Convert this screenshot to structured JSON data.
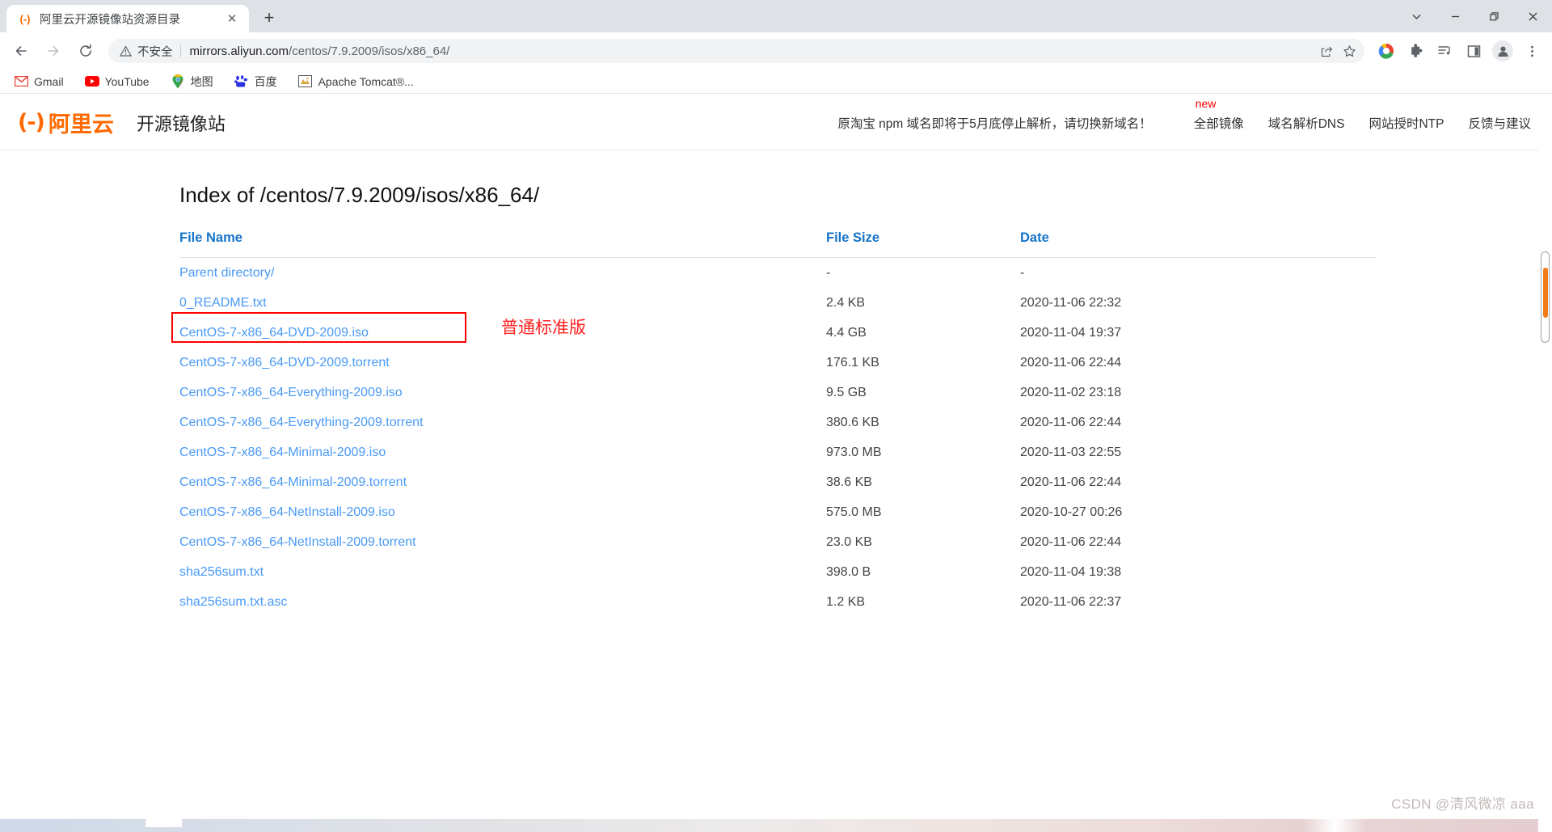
{
  "browser": {
    "tab": {
      "favicon_icon": "aliyun-favicon-icon",
      "favicon_glyph": "(-)",
      "title": "阿里云开源镜像站资源目录",
      "close_icon": "close-icon",
      "close_glyph": "✕"
    },
    "new_tab_glyph": "+",
    "window_controls": [
      {
        "name": "tab-search-button",
        "icon": "chevron-down-icon"
      },
      {
        "name": "minimize-button",
        "icon": "minimize-icon"
      },
      {
        "name": "restore-button",
        "icon": "restore-icon"
      },
      {
        "name": "close-window-button",
        "icon": "close-icon"
      }
    ],
    "toolbar": {
      "back_icon": "back-arrow-icon",
      "forward_icon": "forward-arrow-icon",
      "reload_icon": "reload-icon",
      "security_icon": "warning-triangle-icon",
      "security_label": "不安全",
      "url_host": "mirrors.aliyun.com",
      "url_path": "/centos/7.9.2009/isos/x86_64/",
      "share_icon": "share-icon",
      "bookmark_icon": "star-icon",
      "extensions": [
        {
          "name": "chrome-profile-color-icon",
          "icon": "color-wheel-icon"
        },
        {
          "name": "extensions-puzzle-icon",
          "icon": "puzzle-piece-icon"
        },
        {
          "name": "media-list-icon",
          "icon": "playlist-music-icon"
        },
        {
          "name": "side-panel-icon",
          "icon": "side-panel-icon"
        },
        {
          "name": "profile-avatar",
          "icon": "person-icon"
        },
        {
          "name": "chrome-menu-button",
          "icon": "three-dots-icon"
        }
      ]
    },
    "bookmarks": [
      {
        "label": "Gmail",
        "icon": "gmail-icon"
      },
      {
        "label": "YouTube",
        "icon": "youtube-icon"
      },
      {
        "label": "地图",
        "icon": "google-maps-icon"
      },
      {
        "label": "百度",
        "icon": "baidu-icon"
      },
      {
        "label": "Apache Tomcat®...",
        "icon": "tomcat-icon"
      }
    ]
  },
  "site": {
    "logo_mark": "(-)",
    "logo_name": "阿里云",
    "site_name": "开源镜像站",
    "notice": "原淘宝 npm 域名即将于5月底停止解析，请切换新域名！",
    "nav": [
      {
        "label": "全部镜像",
        "badge": "new"
      },
      {
        "label": "域名解析DNS",
        "badge": ""
      },
      {
        "label": "网站授时NTP",
        "badge": ""
      },
      {
        "label": "反馈与建议",
        "badge": ""
      }
    ]
  },
  "index": {
    "title": "Index of /centos/7.9.2009/isos/x86_64/",
    "columns": {
      "name": "File Name",
      "size": "File Size",
      "date": "Date"
    },
    "annotation": "普通标准版",
    "rows": [
      {
        "name": "Parent directory/",
        "size": "-",
        "date": "-",
        "highlight": false
      },
      {
        "name": "0_README.txt",
        "size": "2.4 KB",
        "date": "2020-11-06 22:32",
        "highlight": false
      },
      {
        "name": "CentOS-7-x86_64-DVD-2009.iso",
        "size": "4.4 GB",
        "date": "2020-11-04 19:37",
        "highlight": true
      },
      {
        "name": "CentOS-7-x86_64-DVD-2009.torrent",
        "size": "176.1 KB",
        "date": "2020-11-06 22:44",
        "highlight": false
      },
      {
        "name": "CentOS-7-x86_64-Everything-2009.iso",
        "size": "9.5 GB",
        "date": "2020-11-02 23:18",
        "highlight": false
      },
      {
        "name": "CentOS-7-x86_64-Everything-2009.torrent",
        "size": "380.6 KB",
        "date": "2020-11-06 22:44",
        "highlight": false
      },
      {
        "name": "CentOS-7-x86_64-Minimal-2009.iso",
        "size": "973.0 MB",
        "date": "2020-11-03 22:55",
        "highlight": false
      },
      {
        "name": "CentOS-7-x86_64-Minimal-2009.torrent",
        "size": "38.6 KB",
        "date": "2020-11-06 22:44",
        "highlight": false
      },
      {
        "name": "CentOS-7-x86_64-NetInstall-2009.iso",
        "size": "575.0 MB",
        "date": "2020-10-27 00:26",
        "highlight": false
      },
      {
        "name": "CentOS-7-x86_64-NetInstall-2009.torrent",
        "size": "23.0 KB",
        "date": "2020-11-06 22:44",
        "highlight": false
      },
      {
        "name": "sha256sum.txt",
        "size": "398.0 B",
        "date": "2020-11-04 19:38",
        "highlight": false
      },
      {
        "name": "sha256sum.txt.asc",
        "size": "1.2 KB",
        "date": "2020-11-06 22:37",
        "highlight": false
      }
    ]
  },
  "watermark": "CSDN @清风微凉 aaa",
  "colors": {
    "link": "#4a9af5",
    "header_link": "#1673c8",
    "aliyun_orange": "#ff6a00",
    "annotation_red": "#ff2020",
    "badge_red": "#ff0000",
    "scrollbar_thumb": "#f07d1a"
  }
}
